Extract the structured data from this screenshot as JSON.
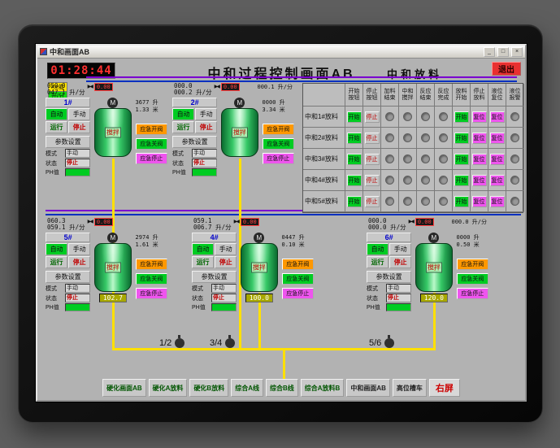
{
  "window": {
    "title": "中和画面AB",
    "min": "_",
    "max": "□",
    "close": "×"
  },
  "header": {
    "time": "01:28:44",
    "title": "中和过程控制画面AB",
    "section_title": "中和放料",
    "exit_label": "退出",
    "badges": [
      "Ke值",
      "升/分"
    ]
  },
  "table": {
    "headers": [
      "开始按钮",
      "停止按钮",
      "加料结束",
      "中和搅拌",
      "反应结束",
      "反应完成",
      "放料开始",
      "停止放料",
      "液位复位",
      "液位报警"
    ],
    "rows": [
      {
        "label": "中和1#放料"
      },
      {
        "label": "中和2#放料"
      },
      {
        "label": "中和3#放料"
      },
      {
        "label": "中和4#放料"
      },
      {
        "label": "中和5#放料"
      }
    ],
    "btn_start": "开始",
    "btn_stop": "停止",
    "btn_reset": "复位"
  },
  "unit_labels": {
    "auto": "自动",
    "manual": "手动",
    "run": "运行",
    "stop": "停止",
    "params": "参数设置",
    "mode_label": "模式",
    "state_label": "状态",
    "ph_label": "PH值",
    "tank_label": "搅拌",
    "em_open": "应急开阀",
    "em_close": "应急关阀",
    "em_stop": "应急停止"
  },
  "units_top": [
    {
      "id": "1#",
      "fa": "050.0",
      "fb": "047.1 升/分",
      "fc": "",
      "sp": "0.00",
      "mode": "手动",
      "state": "停止",
      "ph": "",
      "weight": "3677 升",
      "level": "1.33 米",
      "tankval": ""
    },
    {
      "id": "2#",
      "fa": "000.0",
      "fb": "000.2 升/分",
      "fc": "000.1 升/分",
      "sp": "0.00",
      "mode": "手动",
      "state": "停止",
      "ph": "",
      "weight": "0000 升",
      "level": "3.34 米",
      "tankval": ""
    }
  ],
  "units_bottom": [
    {
      "id": "5#",
      "fa": "060.3",
      "fb": "059.1 升/分",
      "fc": "",
      "sp": "0.00",
      "mode": "手动",
      "state": "停止",
      "ph": "",
      "weight": "2974 升",
      "level": "1.61 米",
      "tankval": "102.7"
    },
    {
      "id": "4#",
      "fa": "059.1",
      "fb": "006.7 升/分",
      "fc": "",
      "sp": "0.00",
      "mode": "手动",
      "state": "停止",
      "ph": "",
      "weight": "0447 升",
      "level": "0.10 米",
      "tankval": "100.0"
    },
    {
      "id": "6#",
      "fa": "000.0",
      "fb": "000.0 升/分",
      "fc": "000.0 升/分",
      "sp": "0.00",
      "mode": "手动",
      "state": "停止",
      "ph": "",
      "weight": "0000 升",
      "level": "0.50 米",
      "tankval": "120.0"
    }
  ],
  "pumps": [
    {
      "label": "1/2"
    },
    {
      "label": "3/4"
    },
    {
      "label": "5/6"
    }
  ],
  "bottom_buttons": [
    {
      "label": "硬化画面AB",
      "accent": "green"
    },
    {
      "label": "硬化A放料",
      "accent": "green"
    },
    {
      "label": "硬化B放料",
      "accent": "green"
    },
    {
      "label": "综合A线",
      "accent": "green"
    },
    {
      "label": "综合B线",
      "accent": "green"
    },
    {
      "label": "综合A放料B",
      "accent": "green"
    },
    {
      "label": "中和画面AB",
      "accent": "dark"
    },
    {
      "label": "高位槽车",
      "accent": "dark"
    },
    {
      "label": "右屏",
      "accent": "red"
    }
  ],
  "colors": {
    "accent_green": "#00cc22",
    "alarm_red": "#c00000",
    "magenta": "#ee55ee",
    "pipe_yellow": "#ffe000",
    "pipe_purple": "#7a00d0"
  }
}
